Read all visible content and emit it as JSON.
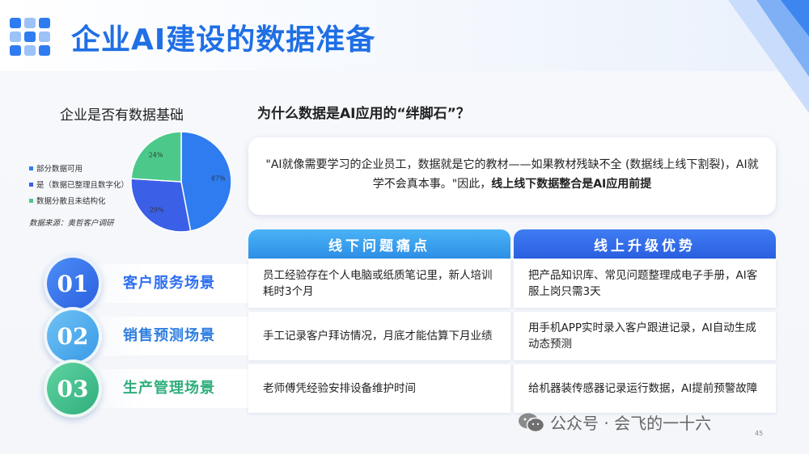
{
  "title": "企业AI建设的数据准备",
  "pie": {
    "title": "企业是否有数据基础",
    "source": "数据来源：奥哲客户调研",
    "slices": [
      {
        "legend": "部分数据可用",
        "percent_label": "47%",
        "value": 47,
        "color": "#2f7cf0"
      },
      {
        "legend": "是（数据已整理且数字化）",
        "percent_label": "29%",
        "value": 29,
        "color": "#3b5fe6"
      },
      {
        "legend": "数据分散且未结构化",
        "percent_label": "24%",
        "value": 24,
        "color": "#4cc98a"
      }
    ]
  },
  "chart_data": {
    "type": "pie",
    "title": "企业是否有数据基础",
    "categories": [
      "部分数据可用",
      "是（数据已整理且数字化）",
      "数据分散且未结构化"
    ],
    "values": [
      47,
      29,
      24
    ],
    "legend": "left"
  },
  "question": "为什么数据是AI应用的“绊脚石”？",
  "quote": {
    "text": "\"AI就像需要学习的企业员工，数据就是它的教材——如果教材残缺不全 (数据线上线下割裂)，AI就学不会真本事。\"因此，",
    "emphasis": "线上线下数据整合是AI应用前提"
  },
  "columns": {
    "offline": "线下问题痛点",
    "online": "线上升级优势"
  },
  "rows": [
    {
      "num": "01",
      "label": "客户服务场景",
      "offline": "员工经验存在个人电脑或纸质笔记里，新人培训耗时3个月",
      "online": "把产品知识库、常见问题整理成电子手册，AI客服上岗只需3天",
      "color": "#2f6ff0",
      "label_color": "#2f6ff0"
    },
    {
      "num": "02",
      "label": "销售预测场景",
      "offline": "手工记录客户拜访情况，月底才能估算下月业绩",
      "online": "用手机APP实时录入客户跟进记录，AI自动生成动态预测",
      "color": "#4aa8ec",
      "label_color": "#2f7ee0"
    },
    {
      "num": "03",
      "label": "生产管理场景",
      "offline": "老师傅凭经验安排设备维护时间",
      "online": "给机器装传感器记录运行数据，AI提前预警故障",
      "color": "#3ec08e",
      "label_color": "#2fae7c"
    }
  ],
  "watermark": "公众号 · 会飞的一十六",
  "page_number": "45"
}
